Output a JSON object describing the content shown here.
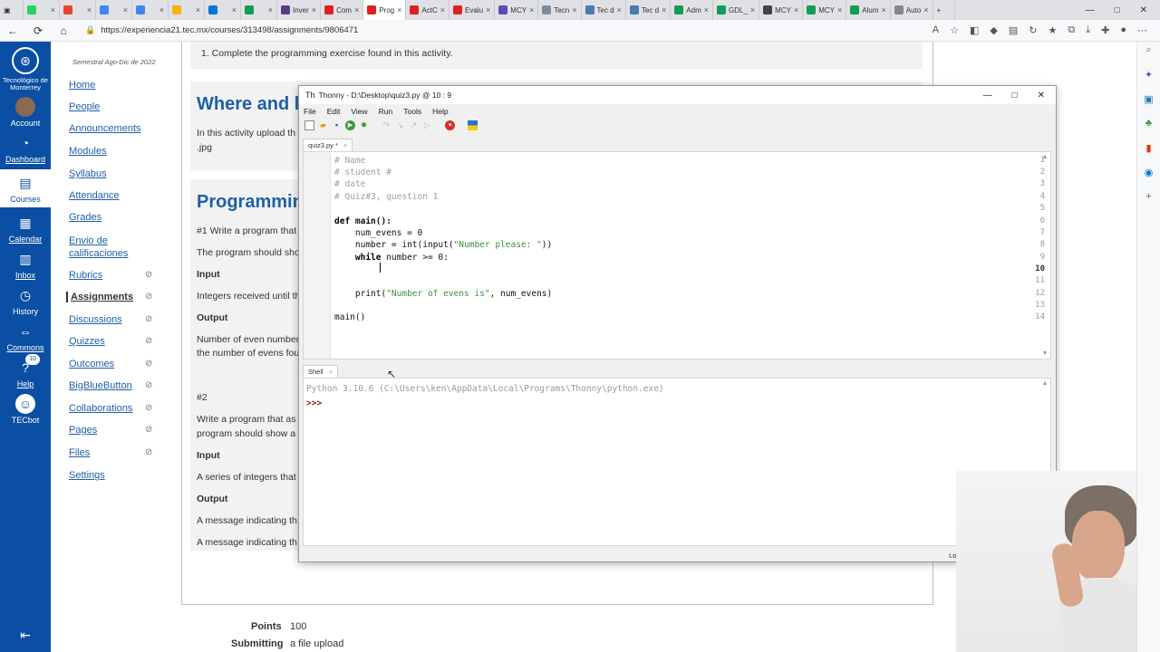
{
  "browser": {
    "tabs": [
      {
        "label": "",
        "color": "#25d366"
      },
      {
        "label": "",
        "color": "#ea4335"
      },
      {
        "label": "",
        "color": "#4285f4"
      },
      {
        "label": "",
        "color": "#4285f4"
      },
      {
        "label": "",
        "color": "#f4b400"
      },
      {
        "label": "",
        "color": "#0078d4"
      },
      {
        "label": "",
        "color": "#0f9d58"
      },
      {
        "label": "Inver",
        "color": "#5b3a8e"
      },
      {
        "label": "Com",
        "color": "#e02020"
      },
      {
        "label": "Prog",
        "color": "#e02020",
        "active": true
      },
      {
        "label": "ActC",
        "color": "#e02020"
      },
      {
        "label": "Evalu",
        "color": "#e02020"
      },
      {
        "label": "MCY",
        "color": "#5e4bb5"
      },
      {
        "label": "Tecn",
        "color": "#7a8c9e"
      },
      {
        "label": "Tec d",
        "color": "#4a7ab5"
      },
      {
        "label": "Tec d",
        "color": "#4a7ab5"
      },
      {
        "label": "Adm",
        "color": "#0f9d58"
      },
      {
        "label": "GDL_",
        "color": "#0f9d58"
      },
      {
        "label": "MCY",
        "color": "#444"
      },
      {
        "label": "MCY",
        "color": "#0f9d58"
      },
      {
        "label": "Alum",
        "color": "#0f9d58"
      },
      {
        "label": "Auto",
        "color": "#888"
      }
    ],
    "new_tab": "+",
    "url": "https://experiencia21.tec.mx/courses/313498/assignments/9806471"
  },
  "global_nav": {
    "logo_text": "Tecnológico de Monterrey",
    "items": [
      {
        "label": "Account"
      },
      {
        "label": "Dashboard"
      },
      {
        "label": "Courses",
        "selected": true
      },
      {
        "label": "Calendar"
      },
      {
        "label": "Inbox"
      },
      {
        "label": "History"
      },
      {
        "label": "Commons"
      },
      {
        "label": "Help",
        "badge": "10"
      },
      {
        "label": "TECbot"
      }
    ]
  },
  "course_nav": {
    "term": "Semestral Ago-Dic de 2022",
    "links": [
      {
        "label": "Home"
      },
      {
        "label": "People"
      },
      {
        "label": "Announcements"
      },
      {
        "label": "Modules"
      },
      {
        "label": "Syllabus"
      },
      {
        "label": "Attendance"
      },
      {
        "label": "Grades"
      },
      {
        "label": "Envio de calificaciones"
      },
      {
        "label": "Rubrics",
        "hidden": true
      },
      {
        "label": "Assignments",
        "hidden": true,
        "selected": true
      },
      {
        "label": "Discussions",
        "hidden": true
      },
      {
        "label": "Quizzes",
        "hidden": true
      },
      {
        "label": "Outcomes",
        "hidden": true
      },
      {
        "label": "BigBlueButton",
        "hidden": true
      },
      {
        "label": "Collaborations",
        "hidden": true
      },
      {
        "label": "Pages",
        "hidden": true
      },
      {
        "label": "Files",
        "hidden": true
      },
      {
        "label": "Settings"
      }
    ]
  },
  "assignment": {
    "step1": "1. Complete the programming exercise found in this activity.",
    "where_heading": "Where and h",
    "where_text1": "In this activity upload th",
    "where_text2": ".jpg",
    "prog_heading": "Programming",
    "p1": "#1 Write a program that",
    "p2": "The program should sho",
    "input1": "Input",
    "input1_text": "Integers received until th",
    "output1": "Output",
    "output1_text1": "Number of even number",
    "output1_text2": "the number of evens fou",
    "p3": "#2",
    "p4": "Write a program that as",
    "p5": "program should show a",
    "input2": "Input",
    "input2_text": "A series of integers that",
    "output2": "Output",
    "output2_text1": "A message indicating th",
    "output2_text2": "A message indicating th",
    "points_label": "Points",
    "points_value": "100",
    "submitting_label": "Submitting",
    "submitting_value": "a file upload"
  },
  "thonny": {
    "title": "Thonny - D:\\Desktop\\quiz3.py @ 10 : 9",
    "menu": [
      "File",
      "Edit",
      "View",
      "Run",
      "Tools",
      "Help"
    ],
    "file_tab": "quiz3.py *",
    "line_numbers": [
      "1",
      "2",
      "3",
      "4",
      "5",
      "6",
      "7",
      "8",
      "9",
      "10",
      "11",
      "12",
      "13",
      "14"
    ],
    "current_line": "10",
    "code": {
      "l1": "# Name",
      "l2": "# student #",
      "l3": "# date",
      "l4": "# Quiz#3, question 1",
      "l6_kw": "def",
      "l6_rest": " main():",
      "l7": "    num_evens = 0",
      "l8_a": "    number = int(input(",
      "l8_str": "\"Number please: \"",
      "l8_b": "))",
      "l9_kw": "    while",
      "l9_rest": " number >= 0:",
      "l12_a": "    print(",
      "l12_str": "\"Number of evens is\"",
      "l12_b": ", num_evens)",
      "l14": "main()"
    },
    "shell_tab": "Shell",
    "shell_version": "Python 3.10.6 (C:\\Users\\ken\\AppData\\Local\\Programs\\Thonny\\python.exe)",
    "shell_prompt": ">>>",
    "status": "Local Python 3  •  Thonny's Python"
  }
}
